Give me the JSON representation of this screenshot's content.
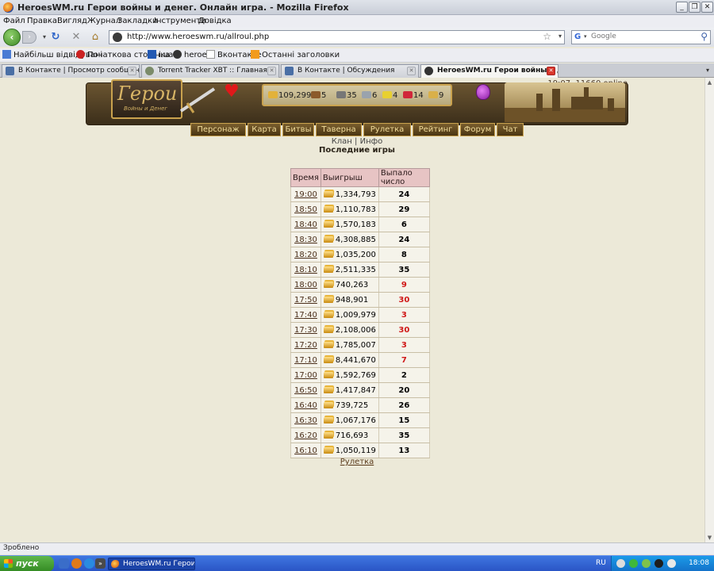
{
  "window": {
    "title": "HeroesWM.ru Герои войны и денег. Онлайн игра. - Mozilla Firefox"
  },
  "menu": [
    "Файл",
    "Правка",
    "Вигляд",
    "Журнал",
    "Закладки",
    "Інструменти",
    "Довідка"
  ],
  "nav": {
    "url": "http://www.heroeswm.ru/allroul.php",
    "search_placeholder": "Google"
  },
  "bookmarks": [
    "Найбільш відвідувані",
    "Початкова сторінка",
    "i.ua",
    "heroes",
    "Вконтакте",
    "Останні заголовки"
  ],
  "tabs": [
    {
      "label": "В Контакте | Просмотр сообщения",
      "active": false
    },
    {
      "label": "Torrent Tracker XBT :: Главная",
      "active": false
    },
    {
      "label": "В Контакте | Обсуждения",
      "active": false
    },
    {
      "label": "HeroesWM.ru Герои войны и ден...",
      "active": true
    }
  ],
  "page": {
    "online": "19:07, 11660 online",
    "logo_text": "Герои",
    "logo_sub": "Войны и Денег",
    "resources": [
      {
        "name": "gold",
        "value": "109,299",
        "color": "#e2b23a"
      },
      {
        "name": "wood",
        "value": "5",
        "color": "#8b5a2b"
      },
      {
        "name": "ore",
        "value": "35",
        "color": "#777777"
      },
      {
        "name": "mercury",
        "value": "6",
        "color": "#9aa3ad"
      },
      {
        "name": "sulfur",
        "value": "4",
        "color": "#e8d030"
      },
      {
        "name": "crystals",
        "value": "14",
        "color": "#d0263a"
      },
      {
        "name": "gems",
        "value": "9",
        "color": "#d9b04a"
      }
    ],
    "game_nav": [
      "Персонаж",
      "Карта",
      "Битвы",
      "Таверна",
      "Рулетка",
      "Рейтинг",
      "Форум",
      "Чат"
    ],
    "sublinks": {
      "clan": "Клан",
      "sep": "|",
      "info": "Инфо"
    },
    "title": "Последние игры",
    "table": {
      "headers": [
        "Время",
        "Выигрыш",
        "Выпало число"
      ],
      "rows": [
        {
          "time": "19:00",
          "win": "1,334,793",
          "num": "24",
          "red": false
        },
        {
          "time": "18:50",
          "win": "1,110,783",
          "num": "29",
          "red": false
        },
        {
          "time": "18:40",
          "win": "1,570,183",
          "num": "6",
          "red": false
        },
        {
          "time": "18:30",
          "win": "4,308,885",
          "num": "24",
          "red": false
        },
        {
          "time": "18:20",
          "win": "1,035,200",
          "num": "8",
          "red": false
        },
        {
          "time": "18:10",
          "win": "2,511,335",
          "num": "35",
          "red": false
        },
        {
          "time": "18:00",
          "win": "740,263",
          "num": "9",
          "red": true
        },
        {
          "time": "17:50",
          "win": "948,901",
          "num": "30",
          "red": true
        },
        {
          "time": "17:40",
          "win": "1,009,979",
          "num": "3",
          "red": true
        },
        {
          "time": "17:30",
          "win": "2,108,006",
          "num": "30",
          "red": true
        },
        {
          "time": "17:20",
          "win": "1,785,007",
          "num": "3",
          "red": true
        },
        {
          "time": "17:10",
          "win": "8,441,670",
          "num": "7",
          "red": true
        },
        {
          "time": "17:00",
          "win": "1,592,769",
          "num": "2",
          "red": false
        },
        {
          "time": "16:50",
          "win": "1,417,847",
          "num": "20",
          "red": false
        },
        {
          "time": "16:40",
          "win": "739,725",
          "num": "26",
          "red": false
        },
        {
          "time": "16:30",
          "win": "1,067,176",
          "num": "15",
          "red": false
        },
        {
          "time": "16:20",
          "win": "716,693",
          "num": "35",
          "red": false
        },
        {
          "time": "16:10",
          "win": "1,050,119",
          "num": "13",
          "red": false
        }
      ]
    },
    "footer_link": "Рулетка"
  },
  "status": "Зроблено",
  "taskbar": {
    "start": "пуск",
    "task": "HeroesWM.ru Герои ...",
    "lang": "RU",
    "clock": "18:08"
  }
}
